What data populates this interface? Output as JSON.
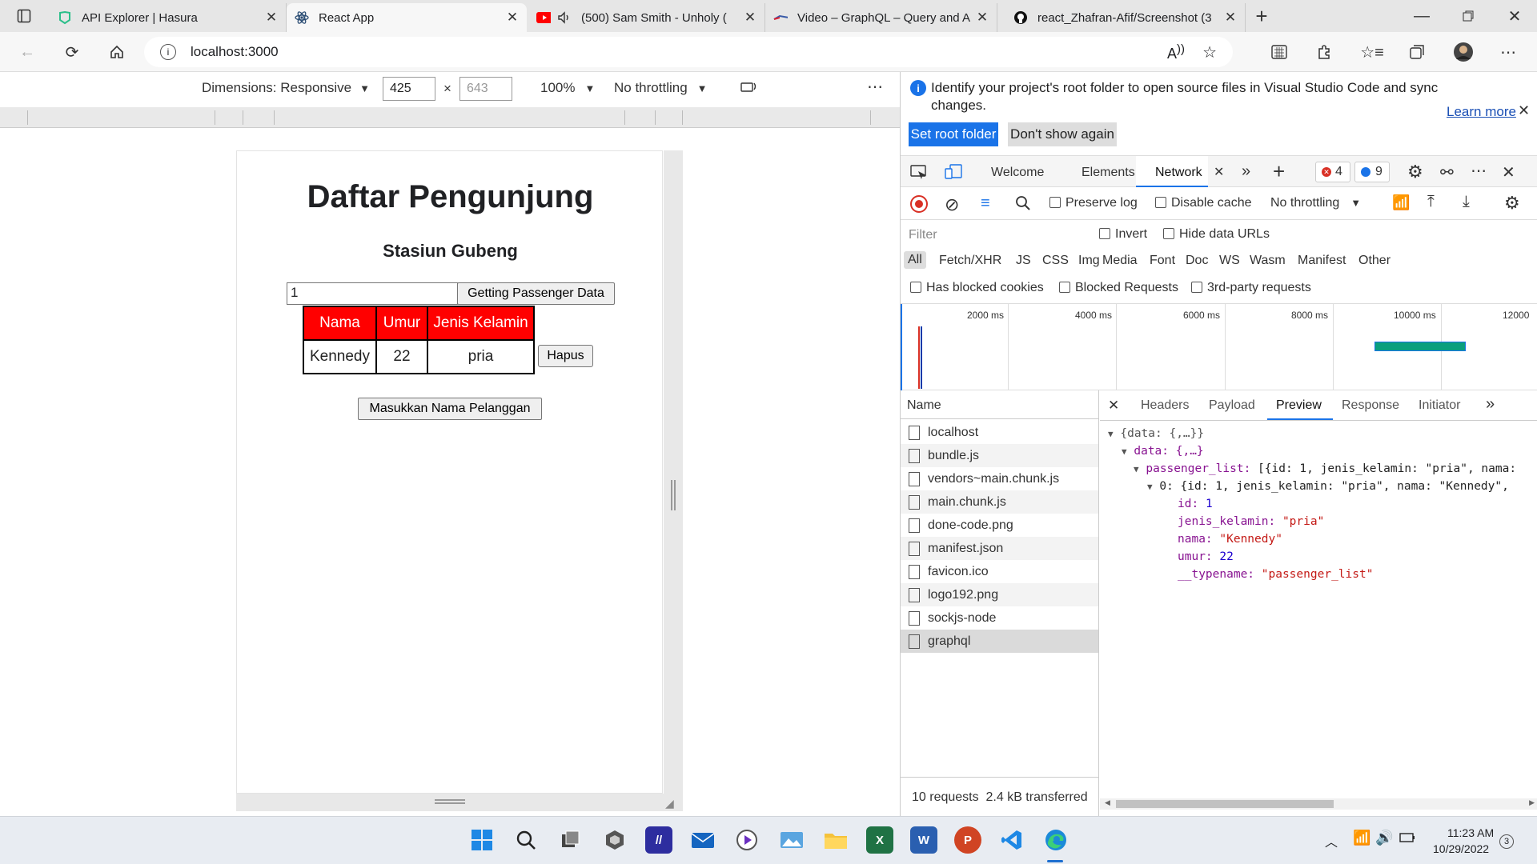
{
  "tabs": [
    {
      "title": "API Explorer | Hasura",
      "icon": "hasura-icon",
      "active": false
    },
    {
      "title": "React App",
      "icon": "react-icon",
      "active": true
    },
    {
      "title": "(500) Sam Smith - Unholy (",
      "icon": "youtube-icon",
      "active": false
    },
    {
      "title": "Video – GraphQL – Query and A",
      "icon": "video-site-icon",
      "active": false
    },
    {
      "title": "react_Zhafran-Afif/Screenshot (3",
      "icon": "github-icon",
      "active": false
    }
  ],
  "address": {
    "url": "localhost:3000"
  },
  "device_toolbar": {
    "dimensions": "Dimensions: Responsive",
    "width": "425",
    "height": "643",
    "times": "×",
    "zoom": "100%",
    "throttling": "No throttling"
  },
  "app": {
    "title": "Daftar Pengunjung",
    "subtitle": "Stasiun Gubeng",
    "id_value": "1",
    "get_button": "Getting Passenger Data",
    "columns": [
      "Nama",
      "Umur",
      "Jenis Kelamin"
    ],
    "rows": [
      {
        "nama": "Kennedy",
        "umur": "22",
        "jk": "pria",
        "action": "Hapus"
      }
    ],
    "add_button": "Masukkan Nama Pelanggan"
  },
  "devtools": {
    "info_text": "Identify your project's root folder to open source files in Visual Studio Code and sync changes.",
    "learn_more": "Learn more",
    "set_root": "Set root folder",
    "dont_show": "Don't show again",
    "panel_tabs": [
      "Welcome",
      "Elements",
      "Network"
    ],
    "errors": "4",
    "messages": "9",
    "preserve_log": "Preserve log",
    "disable_cache": "Disable cache",
    "throttling": "No throttling",
    "filter_placeholder": "Filter",
    "invert": "Invert",
    "hide_data_urls": "Hide data URLs",
    "types": [
      "All",
      "Fetch/XHR",
      "JS",
      "CSS",
      "Img",
      "Media",
      "Font",
      "Doc",
      "WS",
      "Wasm",
      "Manifest",
      "Other"
    ],
    "has_blocked_cookies": "Has blocked cookies",
    "blocked_requests": "Blocked Requests",
    "third_party": "3rd-party requests",
    "timeline_ticks": [
      "2000 ms",
      "4000 ms",
      "6000 ms",
      "8000 ms",
      "10000 ms",
      "12000"
    ],
    "name_header": "Name",
    "requests": [
      "localhost",
      "bundle.js",
      "vendors~main.chunk.js",
      "main.chunk.js",
      "done-code.png",
      "manifest.json",
      "favicon.ico",
      "logo192.png",
      "sockjs-node",
      "graphql"
    ],
    "status": "10 requests  2.4 kB transferred",
    "detail_tabs": [
      "Headers",
      "Payload",
      "Preview",
      "Response",
      "Initiator"
    ],
    "preview": {
      "l1": "{data: {,…}}",
      "l2": "data: {,…}",
      "l3k": "passenger_list:",
      "l3v": "[{id: 1, jenis_kelamin: \"pria\", nama:",
      "l4": "0: {id: 1, jenis_kelamin: \"pria\", nama: \"Kennedy\",",
      "id_k": "id:",
      "id_v": "1",
      "jk_k": "jenis_kelamin:",
      "jk_v": "\"pria\"",
      "nama_k": "nama:",
      "nama_v": "\"Kennedy\"",
      "umur_k": "umur:",
      "umur_v": "22",
      "tn_k": "__typename:",
      "tn_v": "\"passenger_list\""
    }
  },
  "taskbar": {
    "time": "11:23 AM",
    "date": "10/29/2022",
    "notifications": "3"
  }
}
